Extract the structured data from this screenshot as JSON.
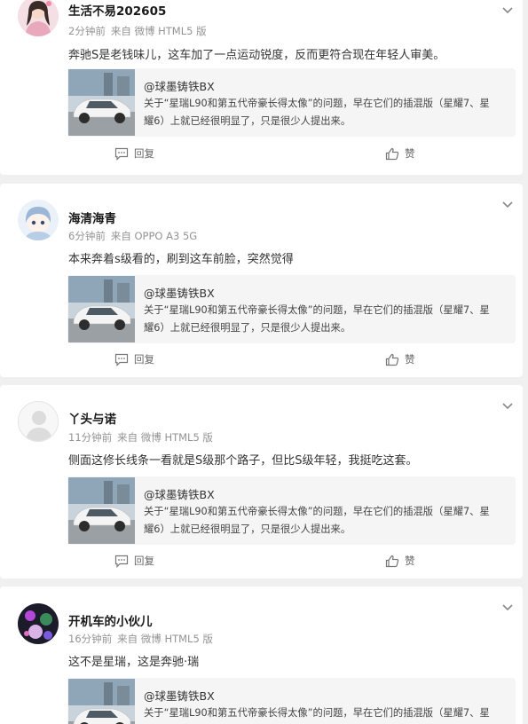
{
  "quote_block": {
    "author": "@球墨铸铁BX",
    "text": "关于“星瑞L90和第五代帝豪长得太像”的问题，早在它们的插混版（星耀7、星耀6）上就已经很明显了，只是很少人提出来。"
  },
  "actions": {
    "reply_label": "回复",
    "like_label": "赞"
  },
  "comments": [
    {
      "username": "生活不易202605",
      "time": "2分钟前",
      "source": "来自 微博 HTML5 版",
      "text": "奔驰S是老钱味儿，这车加了一点运动锐度，反而更符合现在年轻人审美。",
      "avatar_icon": "girl-avatar"
    },
    {
      "username": "海清海青",
      "time": "6分钟前",
      "source": "来自 OPPO A3 5G",
      "text": "本来奔着s级看的，刷到这车前脸，突然觉得",
      "avatar_icon": "anime-avatar"
    },
    {
      "username": "丫头与诺",
      "time": "11分钟前",
      "source": "来自 微博 HTML5 版",
      "text": "侧面这修长线条一看就是S级那个路子，但比S级年轻，我挺吃这套。",
      "avatar_icon": "default-avatar"
    },
    {
      "username": "开机车的小伙儿",
      "time": "16分钟前",
      "source": "来自 微博 HTML5 版",
      "text": "这不是星瑞，这是奔驰·瑞",
      "avatar_icon": "dark-avatar"
    }
  ],
  "colors": {
    "accent": "#ff8200",
    "meta": "#939393",
    "page_bg": "#f0f0f0"
  }
}
